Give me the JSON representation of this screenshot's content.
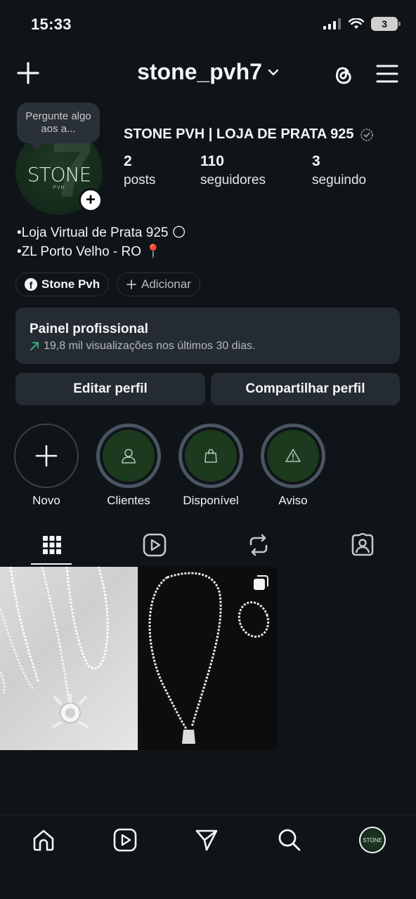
{
  "status_bar": {
    "time": "15:33",
    "battery": "3"
  },
  "header": {
    "username": "stone_pvh7"
  },
  "profile": {
    "note": "Pergunte algo aos a...",
    "avatar_text": "STONE",
    "avatar_sub": "PVH",
    "display_name": "STONE PVH | LOJA DE PRATA 925",
    "stats": [
      {
        "num": "2",
        "label": "posts"
      },
      {
        "num": "110",
        "label": "seguidores"
      },
      {
        "num": "3",
        "label": "seguindo"
      }
    ],
    "bio": [
      "•Loja Virtual de Prata 925 🌕",
      "•ZL Porto Velho - RO 📍"
    ],
    "links": {
      "facebook": "Stone Pvh",
      "add": "Adicionar"
    }
  },
  "panel": {
    "title": "Painel profissional",
    "subtitle": "19,8 mil visualizações nos últimos 30 dias."
  },
  "buttons": {
    "edit": "Editar perfil",
    "share": "Compartilhar perfil"
  },
  "highlights": [
    {
      "label": "Novo",
      "icon": "plus-icon"
    },
    {
      "label": "Clientes",
      "icon": "user-icon"
    },
    {
      "label": "Disponível",
      "icon": "shopping-bag-icon"
    },
    {
      "label": "Aviso",
      "icon": "warning-icon"
    }
  ],
  "tabs": [
    "grid-icon",
    "reels-icon",
    "reposts-icon",
    "tagged-icon"
  ],
  "bottom_nav": [
    "home-icon",
    "reels-icon",
    "direct-icon",
    "search-icon",
    "profile-avatar"
  ],
  "nav_avatar_text": "STONE",
  "colors": {
    "background": "#0f1419",
    "card": "#252b33",
    "highlight_fill": "#1b3a1e",
    "growth_green": "#2ec27e"
  }
}
